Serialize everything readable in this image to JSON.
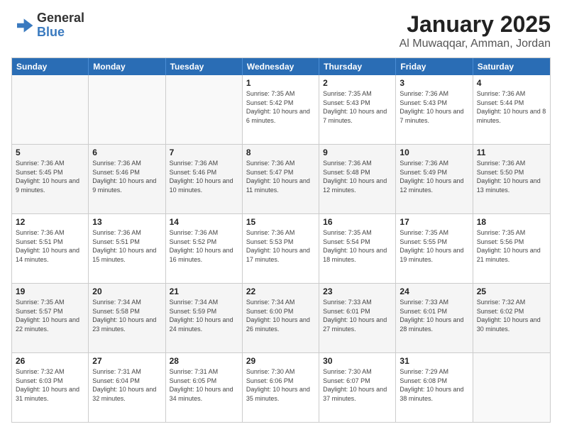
{
  "logo": {
    "general": "General",
    "blue": "Blue"
  },
  "title": "January 2025",
  "subtitle": "Al Muwaqqar, Amman, Jordan",
  "days": [
    "Sunday",
    "Monday",
    "Tuesday",
    "Wednesday",
    "Thursday",
    "Friday",
    "Saturday"
  ],
  "weeks": [
    [
      {
        "day": "",
        "empty": true
      },
      {
        "day": "",
        "empty": true
      },
      {
        "day": "",
        "empty": true
      },
      {
        "day": "1",
        "sunrise": "Sunrise: 7:35 AM",
        "sunset": "Sunset: 5:42 PM",
        "daylight": "Daylight: 10 hours and 6 minutes."
      },
      {
        "day": "2",
        "sunrise": "Sunrise: 7:35 AM",
        "sunset": "Sunset: 5:43 PM",
        "daylight": "Daylight: 10 hours and 7 minutes."
      },
      {
        "day": "3",
        "sunrise": "Sunrise: 7:36 AM",
        "sunset": "Sunset: 5:43 PM",
        "daylight": "Daylight: 10 hours and 7 minutes."
      },
      {
        "day": "4",
        "sunrise": "Sunrise: 7:36 AM",
        "sunset": "Sunset: 5:44 PM",
        "daylight": "Daylight: 10 hours and 8 minutes."
      }
    ],
    [
      {
        "day": "5",
        "sunrise": "Sunrise: 7:36 AM",
        "sunset": "Sunset: 5:45 PM",
        "daylight": "Daylight: 10 hours and 9 minutes."
      },
      {
        "day": "6",
        "sunrise": "Sunrise: 7:36 AM",
        "sunset": "Sunset: 5:46 PM",
        "daylight": "Daylight: 10 hours and 9 minutes."
      },
      {
        "day": "7",
        "sunrise": "Sunrise: 7:36 AM",
        "sunset": "Sunset: 5:46 PM",
        "daylight": "Daylight: 10 hours and 10 minutes."
      },
      {
        "day": "8",
        "sunrise": "Sunrise: 7:36 AM",
        "sunset": "Sunset: 5:47 PM",
        "daylight": "Daylight: 10 hours and 11 minutes."
      },
      {
        "day": "9",
        "sunrise": "Sunrise: 7:36 AM",
        "sunset": "Sunset: 5:48 PM",
        "daylight": "Daylight: 10 hours and 12 minutes."
      },
      {
        "day": "10",
        "sunrise": "Sunrise: 7:36 AM",
        "sunset": "Sunset: 5:49 PM",
        "daylight": "Daylight: 10 hours and 12 minutes."
      },
      {
        "day": "11",
        "sunrise": "Sunrise: 7:36 AM",
        "sunset": "Sunset: 5:50 PM",
        "daylight": "Daylight: 10 hours and 13 minutes."
      }
    ],
    [
      {
        "day": "12",
        "sunrise": "Sunrise: 7:36 AM",
        "sunset": "Sunset: 5:51 PM",
        "daylight": "Daylight: 10 hours and 14 minutes."
      },
      {
        "day": "13",
        "sunrise": "Sunrise: 7:36 AM",
        "sunset": "Sunset: 5:51 PM",
        "daylight": "Daylight: 10 hours and 15 minutes."
      },
      {
        "day": "14",
        "sunrise": "Sunrise: 7:36 AM",
        "sunset": "Sunset: 5:52 PM",
        "daylight": "Daylight: 10 hours and 16 minutes."
      },
      {
        "day": "15",
        "sunrise": "Sunrise: 7:36 AM",
        "sunset": "Sunset: 5:53 PM",
        "daylight": "Daylight: 10 hours and 17 minutes."
      },
      {
        "day": "16",
        "sunrise": "Sunrise: 7:35 AM",
        "sunset": "Sunset: 5:54 PM",
        "daylight": "Daylight: 10 hours and 18 minutes."
      },
      {
        "day": "17",
        "sunrise": "Sunrise: 7:35 AM",
        "sunset": "Sunset: 5:55 PM",
        "daylight": "Daylight: 10 hours and 19 minutes."
      },
      {
        "day": "18",
        "sunrise": "Sunrise: 7:35 AM",
        "sunset": "Sunset: 5:56 PM",
        "daylight": "Daylight: 10 hours and 21 minutes."
      }
    ],
    [
      {
        "day": "19",
        "sunrise": "Sunrise: 7:35 AM",
        "sunset": "Sunset: 5:57 PM",
        "daylight": "Daylight: 10 hours and 22 minutes."
      },
      {
        "day": "20",
        "sunrise": "Sunrise: 7:34 AM",
        "sunset": "Sunset: 5:58 PM",
        "daylight": "Daylight: 10 hours and 23 minutes."
      },
      {
        "day": "21",
        "sunrise": "Sunrise: 7:34 AM",
        "sunset": "Sunset: 5:59 PM",
        "daylight": "Daylight: 10 hours and 24 minutes."
      },
      {
        "day": "22",
        "sunrise": "Sunrise: 7:34 AM",
        "sunset": "Sunset: 6:00 PM",
        "daylight": "Daylight: 10 hours and 26 minutes."
      },
      {
        "day": "23",
        "sunrise": "Sunrise: 7:33 AM",
        "sunset": "Sunset: 6:01 PM",
        "daylight": "Daylight: 10 hours and 27 minutes."
      },
      {
        "day": "24",
        "sunrise": "Sunrise: 7:33 AM",
        "sunset": "Sunset: 6:01 PM",
        "daylight": "Daylight: 10 hours and 28 minutes."
      },
      {
        "day": "25",
        "sunrise": "Sunrise: 7:32 AM",
        "sunset": "Sunset: 6:02 PM",
        "daylight": "Daylight: 10 hours and 30 minutes."
      }
    ],
    [
      {
        "day": "26",
        "sunrise": "Sunrise: 7:32 AM",
        "sunset": "Sunset: 6:03 PM",
        "daylight": "Daylight: 10 hours and 31 minutes."
      },
      {
        "day": "27",
        "sunrise": "Sunrise: 7:31 AM",
        "sunset": "Sunset: 6:04 PM",
        "daylight": "Daylight: 10 hours and 32 minutes."
      },
      {
        "day": "28",
        "sunrise": "Sunrise: 7:31 AM",
        "sunset": "Sunset: 6:05 PM",
        "daylight": "Daylight: 10 hours and 34 minutes."
      },
      {
        "day": "29",
        "sunrise": "Sunrise: 7:30 AM",
        "sunset": "Sunset: 6:06 PM",
        "daylight": "Daylight: 10 hours and 35 minutes."
      },
      {
        "day": "30",
        "sunrise": "Sunrise: 7:30 AM",
        "sunset": "Sunset: 6:07 PM",
        "daylight": "Daylight: 10 hours and 37 minutes."
      },
      {
        "day": "31",
        "sunrise": "Sunrise: 7:29 AM",
        "sunset": "Sunset: 6:08 PM",
        "daylight": "Daylight: 10 hours and 38 minutes."
      },
      {
        "day": "",
        "empty": true
      }
    ]
  ]
}
